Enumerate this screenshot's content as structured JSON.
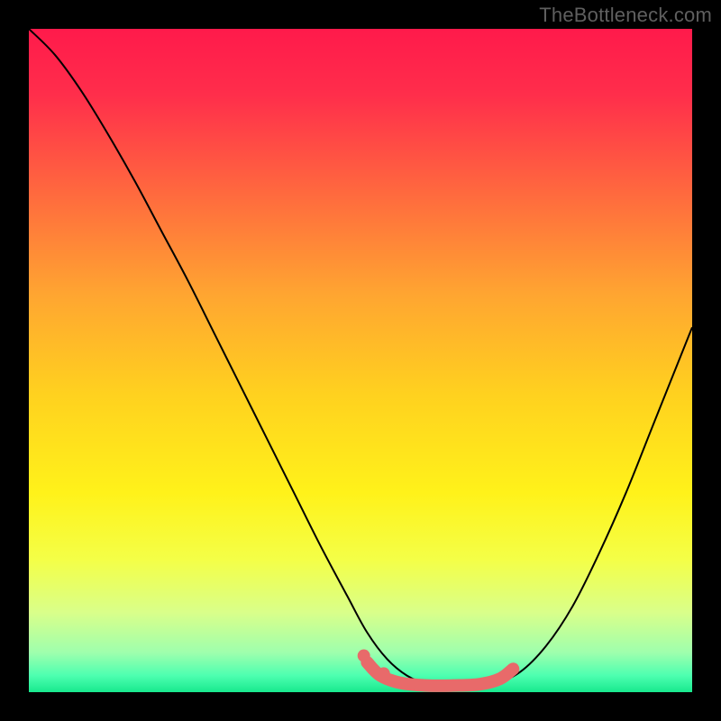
{
  "attribution": "TheBottleneck.com",
  "chart_data": {
    "type": "line",
    "title": "",
    "xlabel": "",
    "ylabel": "",
    "xlim": [
      0,
      100
    ],
    "ylim": [
      0,
      100
    ],
    "gradient_stops": [
      {
        "offset": 0.0,
        "color": "#ff1a4b"
      },
      {
        "offset": 0.1,
        "color": "#ff2e4b"
      },
      {
        "offset": 0.25,
        "color": "#ff6a3e"
      },
      {
        "offset": 0.4,
        "color": "#ffa531"
      },
      {
        "offset": 0.55,
        "color": "#ffd11f"
      },
      {
        "offset": 0.7,
        "color": "#fff21a"
      },
      {
        "offset": 0.8,
        "color": "#f4ff47"
      },
      {
        "offset": 0.88,
        "color": "#d9ff8a"
      },
      {
        "offset": 0.94,
        "color": "#9fffad"
      },
      {
        "offset": 0.975,
        "color": "#4dffb0"
      },
      {
        "offset": 1.0,
        "color": "#18e98e"
      }
    ],
    "series": [
      {
        "name": "bottleneck-curve",
        "color": "#000000",
        "stroke_width": 2,
        "x": [
          0,
          4,
          8,
          12,
          16,
          20,
          24,
          28,
          32,
          36,
          40,
          44,
          48,
          51,
          54,
          57,
          60,
          63,
          66,
          70,
          74,
          78,
          82,
          86,
          90,
          94,
          98,
          100
        ],
        "y": [
          100,
          96,
          90.5,
          84,
          77,
          69.5,
          62,
          54,
          46,
          38,
          30,
          22,
          14.5,
          9,
          5,
          2.5,
          1.3,
          1.0,
          1.0,
          1.3,
          3,
          7,
          13,
          21,
          30,
          40,
          50,
          55
        ]
      },
      {
        "name": "highlight-band",
        "color": "#e86a6a",
        "stroke_width": 14,
        "linecap": "round",
        "x": [
          51,
          53,
          56,
          60,
          64,
          68,
          71,
          73
        ],
        "y": [
          4.5,
          2.5,
          1.4,
          1.0,
          1.0,
          1.2,
          2.0,
          3.5
        ]
      }
    ],
    "markers": [
      {
        "series": "highlight-band",
        "x": 50.5,
        "y": 5.5,
        "r": 7,
        "color": "#e86a6a"
      },
      {
        "series": "highlight-band",
        "x": 53.5,
        "y": 2.8,
        "r": 7,
        "color": "#e86a6a"
      }
    ]
  }
}
